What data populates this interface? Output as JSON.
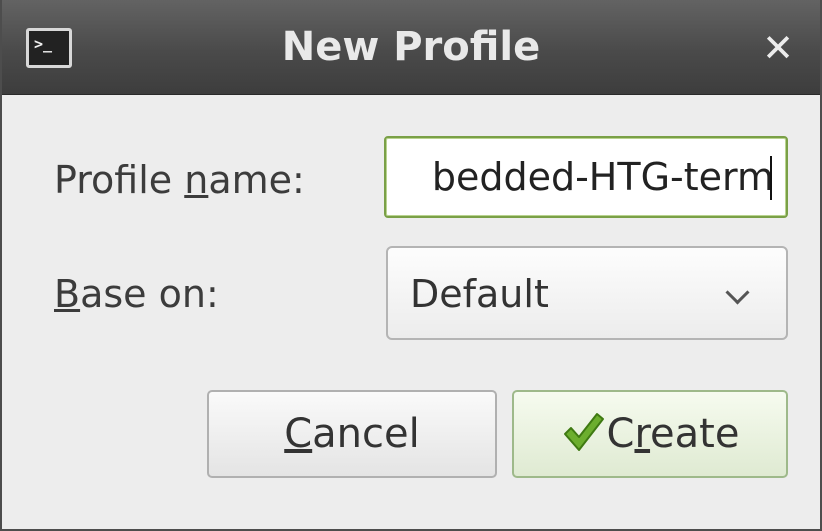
{
  "window": {
    "title": "New Profile",
    "title_icon": "terminal-icon",
    "close_icon": "close-icon",
    "close_glyph": "✕"
  },
  "form": {
    "profile_name": {
      "label_pre": "Profile ",
      "label_mnemonic": "n",
      "label_post": "ame:",
      "value": "bedded-HTG-term"
    },
    "base_on": {
      "label_mnemonic": "B",
      "label_post": "ase on:",
      "selected": "Default",
      "arrow_icon": "chevron-down-icon"
    }
  },
  "buttons": {
    "cancel": {
      "mnemonic": "C",
      "rest": "ancel"
    },
    "create": {
      "pre": "C",
      "mnemonic": "r",
      "post": "eate",
      "icon": "checkmark-icon",
      "icon_color": "#6cae2e"
    }
  }
}
